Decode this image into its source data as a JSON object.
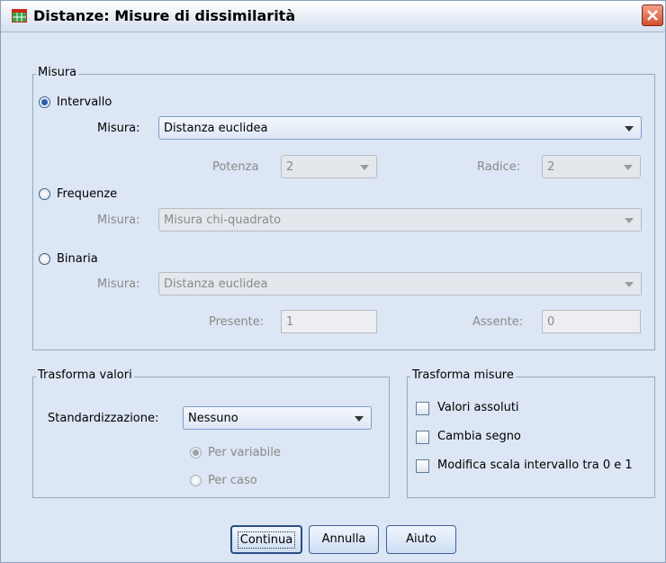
{
  "window": {
    "title": "Distanze: Misure di dissimilarità",
    "icon": "data-grid-icon",
    "close_icon": "close-icon"
  },
  "misura": {
    "legend": "Misura",
    "intervallo": {
      "label": "Intervallo",
      "selected": true,
      "measure_label": "Misura:",
      "measure_value": "Distanza euclidea",
      "potenza_label": "Potenza",
      "potenza_value": "2",
      "radice_label": "Radice:",
      "radice_value": "2"
    },
    "frequenze": {
      "label": "Frequenze",
      "selected": false,
      "measure_label": "Misura:",
      "measure_value": "Misura chi-quadrato"
    },
    "binaria": {
      "label": "Binaria",
      "selected": false,
      "measure_label": "Misura:",
      "measure_value": "Distanza euclidea",
      "presente_label": "Presente:",
      "presente_value": "1",
      "assente_label": "Assente:",
      "assente_value": "0"
    }
  },
  "trasforma_valori": {
    "legend": "Trasforma valori",
    "standardizzazione_label": "Standardizzazione:",
    "standardizzazione_value": "Nessuno",
    "per_variabile": "Per variabile",
    "per_caso": "Per caso"
  },
  "trasforma_misure": {
    "legend": "Trasforma misure",
    "valori_assoluti": "Valori assoluti",
    "cambia_segno": "Cambia segno",
    "modifica_scala": "Modifica scala intervallo tra 0 e 1"
  },
  "buttons": {
    "continua": "Continua",
    "annulla": "Annulla",
    "aiuto": "Aiuto"
  }
}
